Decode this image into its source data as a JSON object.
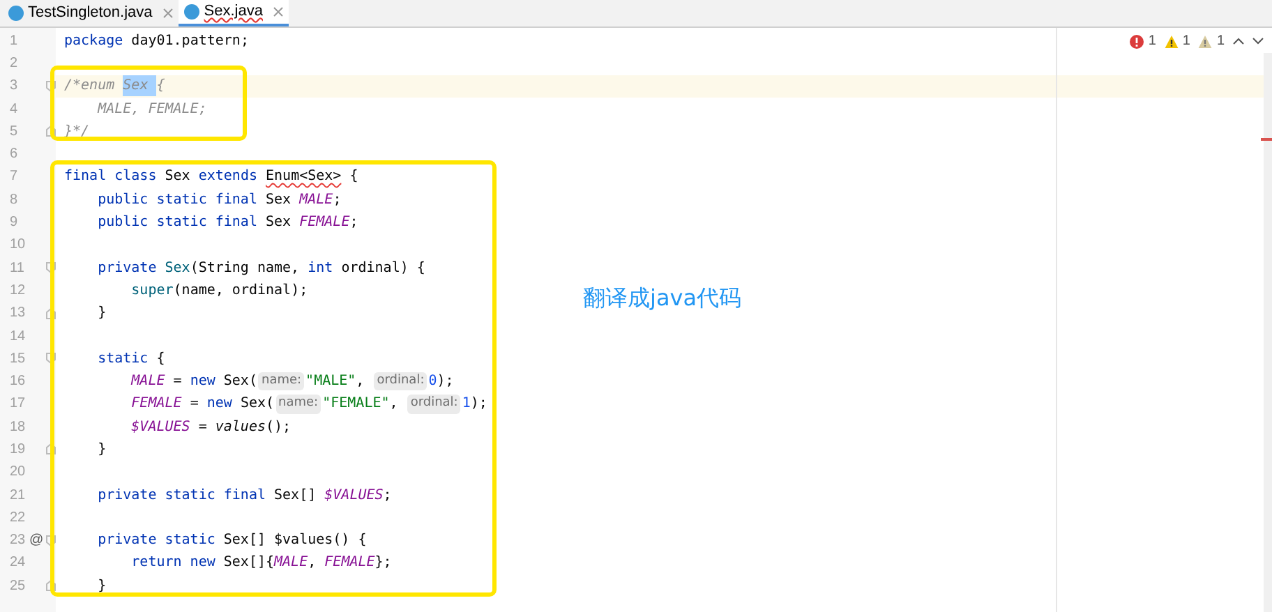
{
  "tabs": [
    {
      "label": "TestSingleton.java",
      "selected": false,
      "error": false
    },
    {
      "label": "Sex.java",
      "selected": true,
      "error": true
    }
  ],
  "inspections": [
    {
      "kind": "error",
      "count": "1"
    },
    {
      "kind": "warning",
      "count": "1"
    },
    {
      "kind": "weak_warning",
      "count": "1"
    }
  ],
  "lines": [
    {
      "number": "1",
      "tokens": [
        {
          "kind": "keyword",
          "text": "package"
        },
        {
          "kind": "plain",
          "text": " day01.pattern;"
        }
      ]
    },
    {
      "number": "2"
    },
    {
      "number": "3",
      "current": true,
      "fold_start": true,
      "tokens": [
        {
          "kind": "comment",
          "text": "/*enum "
        },
        {
          "kind": "selected",
          "text": "Sex "
        },
        {
          "kind": "comment",
          "text": "{"
        }
      ]
    },
    {
      "number": "4",
      "tokens": [
        {
          "kind": "comment",
          "text": "    MALE, FEMALE;"
        }
      ]
    },
    {
      "number": "5",
      "fold_end": true,
      "tokens": [
        {
          "kind": "comment",
          "text": "}*/"
        }
      ]
    },
    {
      "number": "6"
    },
    {
      "number": "7",
      "tokens": [
        {
          "kind": "keyword",
          "text": "final class "
        },
        {
          "kind": "plain",
          "text": "Sex "
        },
        {
          "kind": "keyword",
          "text": "extends "
        },
        {
          "kind": "error",
          "text": "Enum<Sex>"
        },
        {
          "kind": "plain",
          "text": " {"
        }
      ]
    },
    {
      "number": "8",
      "tokens": [
        {
          "kind": "keyword",
          "text": "    public static final "
        },
        {
          "kind": "plain",
          "text": "Sex "
        },
        {
          "kind": "field",
          "text": "MALE"
        },
        {
          "kind": "plain",
          "text": ";"
        }
      ]
    },
    {
      "number": "9",
      "tokens": [
        {
          "kind": "keyword",
          "text": "    public static final "
        },
        {
          "kind": "plain",
          "text": "Sex "
        },
        {
          "kind": "field",
          "text": "FEMALE"
        },
        {
          "kind": "plain",
          "text": ";"
        }
      ]
    },
    {
      "number": "10"
    },
    {
      "number": "11",
      "fold_start": true,
      "tokens": [
        {
          "kind": "keyword",
          "text": "    private "
        },
        {
          "kind": "declaration",
          "text": "Sex"
        },
        {
          "kind": "plain",
          "text": "(String name, "
        },
        {
          "kind": "keyword",
          "text": "int"
        },
        {
          "kind": "plain",
          "text": " ordinal) {"
        }
      ]
    },
    {
      "number": "12",
      "tokens": [
        {
          "kind": "declaration",
          "text": "        super"
        },
        {
          "kind": "plain",
          "text": "(name, ordinal);"
        }
      ]
    },
    {
      "number": "13",
      "fold_end": true,
      "tokens": [
        {
          "kind": "plain",
          "text": "    }"
        }
      ]
    },
    {
      "number": "14"
    },
    {
      "number": "15",
      "fold_start": true,
      "tokens": [
        {
          "kind": "keyword",
          "text": "    static"
        },
        {
          "kind": "plain",
          "text": " {"
        }
      ]
    },
    {
      "number": "16",
      "tokens": [
        {
          "kind": "field",
          "text": "        MALE"
        },
        {
          "kind": "plain",
          "text": " = "
        },
        {
          "kind": "keyword",
          "text": "new"
        },
        {
          "kind": "plain",
          "text": " Sex("
        },
        {
          "kind": "hint",
          "text": "name:"
        },
        {
          "kind": "string",
          "text": "\"MALE\""
        },
        {
          "kind": "plain",
          "text": ", "
        },
        {
          "kind": "hint",
          "text": "ordinal:"
        },
        {
          "kind": "number",
          "text": "0"
        },
        {
          "kind": "plain",
          "text": ");"
        }
      ]
    },
    {
      "number": "17",
      "tokens": [
        {
          "kind": "field",
          "text": "        FEMALE"
        },
        {
          "kind": "plain",
          "text": " = "
        },
        {
          "kind": "keyword",
          "text": "new"
        },
        {
          "kind": "plain",
          "text": " Sex("
        },
        {
          "kind": "hint",
          "text": "name:"
        },
        {
          "kind": "string",
          "text": "\"FEMALE\""
        },
        {
          "kind": "plain",
          "text": ", "
        },
        {
          "kind": "hint",
          "text": "ordinal:"
        },
        {
          "kind": "number",
          "text": "1"
        },
        {
          "kind": "plain",
          "text": ");"
        }
      ]
    },
    {
      "number": "18",
      "tokens": [
        {
          "kind": "field",
          "text": "        $VALUES"
        },
        {
          "kind": "plain",
          "text": " = "
        },
        {
          "kind": "static_call",
          "text": "values"
        },
        {
          "kind": "plain",
          "text": "();"
        }
      ]
    },
    {
      "number": "19",
      "fold_end": true,
      "tokens": [
        {
          "kind": "plain",
          "text": "    }"
        }
      ]
    },
    {
      "number": "20"
    },
    {
      "number": "21",
      "tokens": [
        {
          "kind": "keyword",
          "text": "    private static final "
        },
        {
          "kind": "plain",
          "text": "Sex[] "
        },
        {
          "kind": "field",
          "text": "$VALUES"
        },
        {
          "kind": "plain",
          "text": ";"
        }
      ]
    },
    {
      "number": "22"
    },
    {
      "number": "23",
      "gutter_mark": "@",
      "fold_start": true,
      "tokens": [
        {
          "kind": "keyword",
          "text": "    private static "
        },
        {
          "kind": "plain",
          "text": "Sex[] $values() {"
        }
      ]
    },
    {
      "number": "24",
      "tokens": [
        {
          "kind": "keyword",
          "text": "        return new "
        },
        {
          "kind": "plain",
          "text": "Sex[]{"
        },
        {
          "kind": "field",
          "text": "MALE"
        },
        {
          "kind": "plain",
          "text": ", "
        },
        {
          "kind": "field",
          "text": "FEMALE"
        },
        {
          "kind": "plain",
          "text": "};"
        }
      ]
    },
    {
      "number": "25",
      "fold_end": true,
      "tokens": [
        {
          "kind": "plain",
          "text": "    }"
        }
      ]
    }
  ],
  "annotation": {
    "text": "翻译成java代码"
  }
}
